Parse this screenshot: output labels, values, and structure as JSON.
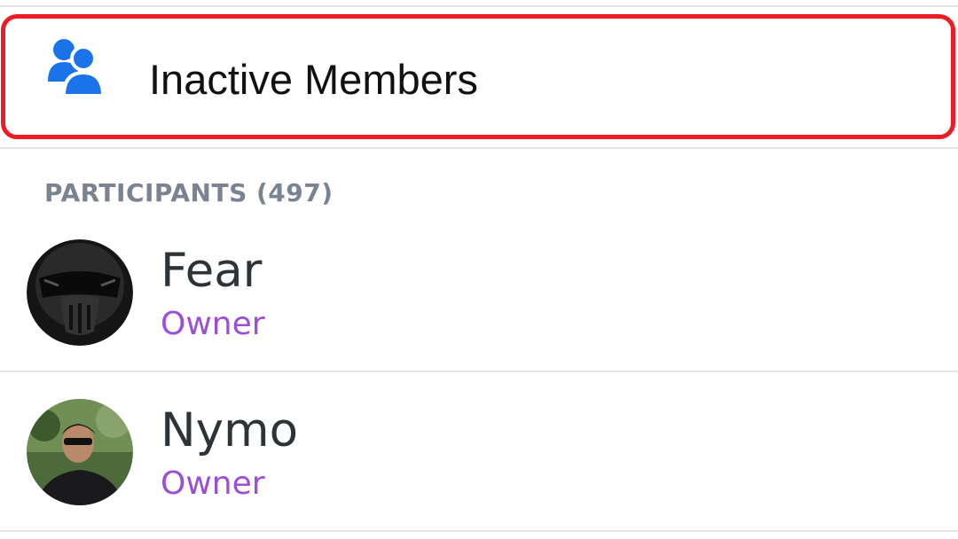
{
  "inactive_members": {
    "label": "Inactive Members",
    "icon": "people-icon",
    "icon_color": "#1a73e8",
    "highlight_color": "#ed1c24"
  },
  "participants": {
    "header": "PARTICIPANTS (497)",
    "members": [
      {
        "name": "Fear",
        "role": "Owner",
        "avatar": "masked-rider-avatar"
      },
      {
        "name": "Nymo",
        "role": "Owner",
        "avatar": "man-sunglasses-avatar"
      }
    ]
  },
  "colors": {
    "role_owner": "#9a4fd6",
    "divider": "#e3e5e8",
    "section_header": "#7a8391"
  }
}
